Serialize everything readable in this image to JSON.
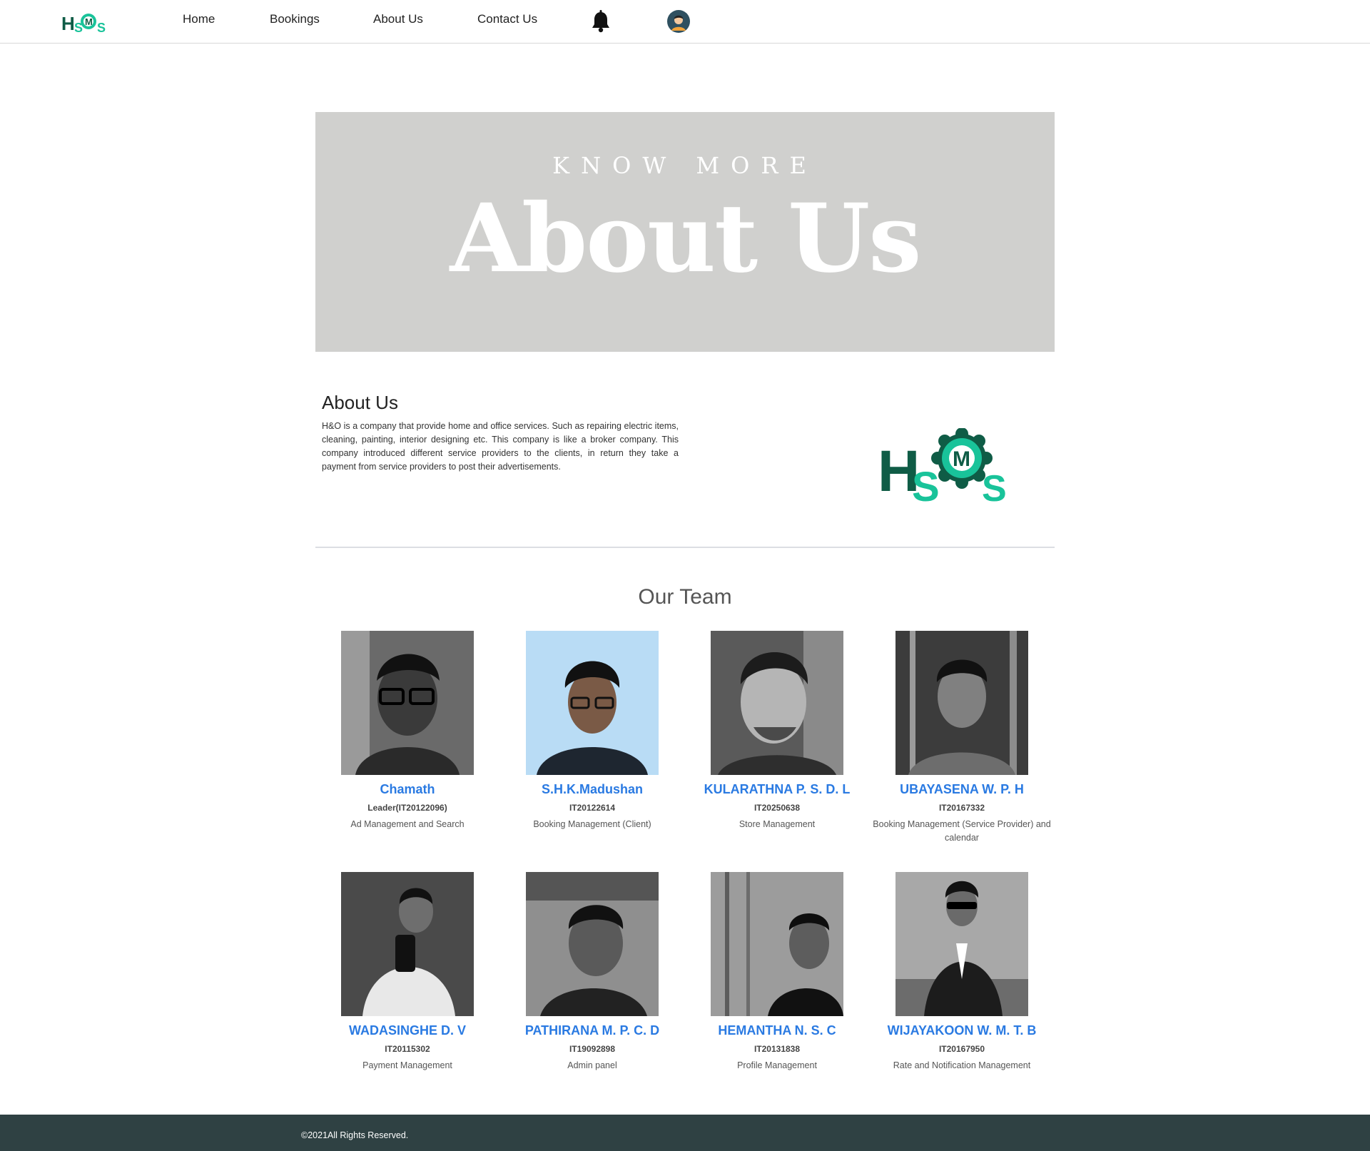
{
  "brand": {
    "logo_letters": [
      "H",
      "S",
      "M",
      "S"
    ],
    "colors": {
      "dark_green": "#0f5c46",
      "light_teal": "#19c39a",
      "link_blue": "#2a7ae2",
      "footer_bg": "#2f4143",
      "hero_bg": "#d0d0ce"
    }
  },
  "nav": {
    "items": [
      "Home",
      "Bookings",
      "About Us",
      "Contact Us"
    ],
    "bell_icon": "bell-icon",
    "avatar_icon": "user-avatar-icon"
  },
  "hero": {
    "kicker": "KNOW MORE",
    "title": "About Us"
  },
  "about": {
    "heading": "About Us",
    "text": "H&O is a company that provide home and office services. Such as repairing electric items, cleaning, painting, interior designing etc. This company is like a broker company. This company introduced different service providers to the clients, in return they take a payment from service providers to post their advertisements."
  },
  "team": {
    "title": "Our Team",
    "members": [
      {
        "name": "Chamath",
        "id": "Leader(IT20122096)",
        "role": "Ad Management and Search"
      },
      {
        "name": "S.H.K.Madushan",
        "id": "IT20122614",
        "role": "Booking Management (Client)"
      },
      {
        "name": "KULARATHNA P. S. D. L",
        "id": "IT20250638",
        "role": "Store Management"
      },
      {
        "name": "UBAYASENA W. P. H",
        "id": "IT20167332",
        "role": "Booking Management (Service Provider) and calendar"
      },
      {
        "name": "WADASINGHE D. V",
        "id": "IT20115302",
        "role": "Payment Management"
      },
      {
        "name": "PATHIRANA M. P. C. D",
        "id": "IT19092898",
        "role": "Admin panel"
      },
      {
        "name": "HEMANTHA N. S. C",
        "id": "IT20131838",
        "role": "Profile Management"
      },
      {
        "name": "WIJAYAKOON W. M. T. B",
        "id": "IT20167950",
        "role": "Rate and Notification Management"
      }
    ]
  },
  "footer": {
    "text": "©2021All Rights Reserved."
  }
}
